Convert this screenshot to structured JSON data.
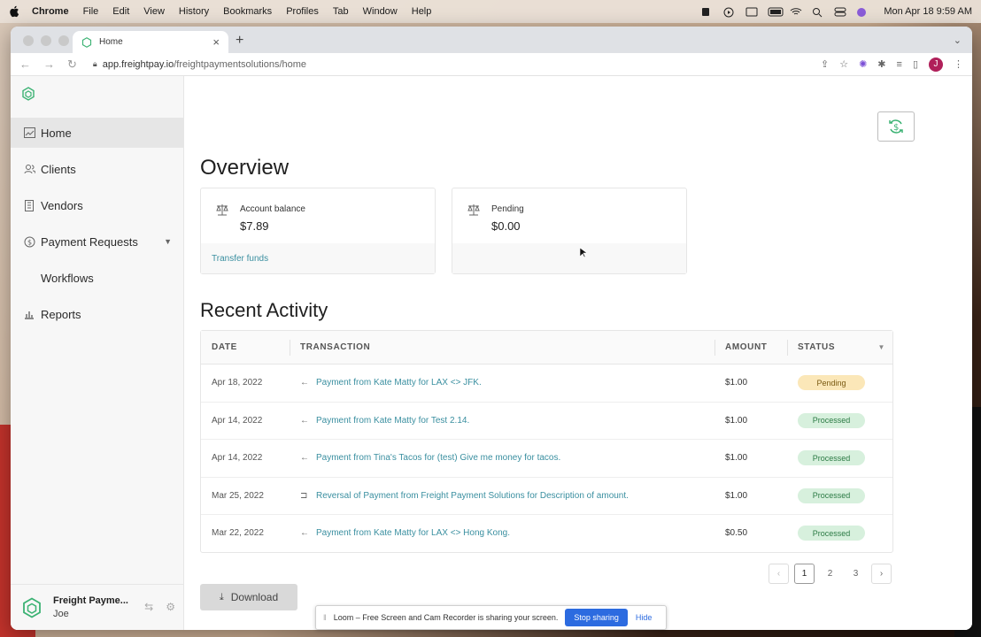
{
  "menubar": {
    "app": "Chrome",
    "items": [
      "File",
      "Edit",
      "View",
      "History",
      "Bookmarks",
      "Profiles",
      "Tab",
      "Window",
      "Help"
    ],
    "clock": "Mon Apr 18  9:59 AM"
  },
  "browser": {
    "tab_title": "Home",
    "url_host": "app.freightpay.io",
    "url_path": "/freightpaymentsolutions/home",
    "profile_initial": "J"
  },
  "sidebar": {
    "items": [
      {
        "label": "Home",
        "icon": "chart-line-icon"
      },
      {
        "label": "Clients",
        "icon": "users-icon"
      },
      {
        "label": "Vendors",
        "icon": "building-icon"
      },
      {
        "label": "Payment Requests",
        "icon": "dollar-circle-icon"
      },
      {
        "label": "Workflows",
        "icon": "workflow-icon"
      },
      {
        "label": "Reports",
        "icon": "bar-chart-icon"
      }
    ],
    "company": "Freight Payme...",
    "user": "Joe"
  },
  "overview": {
    "title": "Overview",
    "balance_label": "Account balance",
    "balance_value": "$7.89",
    "transfer_link": "Transfer funds",
    "pending_label": "Pending",
    "pending_value": "$0.00"
  },
  "activity": {
    "title": "Recent Activity",
    "columns": {
      "date": "DATE",
      "transaction": "TRANSACTION",
      "amount": "AMOUNT",
      "status": "STATUS"
    },
    "rows": [
      {
        "date": "Apr 18, 2022",
        "tx": "Payment from Kate Matty for LAX <> JFK.",
        "amount": "$1.00",
        "status": "Pending"
      },
      {
        "date": "Apr 14, 2022",
        "tx": "Payment from Kate Matty for Test 2.14.",
        "amount": "$1.00",
        "status": "Processed"
      },
      {
        "date": "Apr 14, 2022",
        "tx": "Payment from Tina's Tacos for (test) Give me money for tacos.",
        "amount": "$1.00",
        "status": "Processed"
      },
      {
        "date": "Mar 25, 2022",
        "tx": "Reversal of Payment from Freight Payment Solutions for Description of amount.",
        "amount": "$1.00",
        "status": "Processed"
      },
      {
        "date": "Mar 22, 2022",
        "tx": "Payment from Kate Matty for LAX <> Hong Kong.",
        "amount": "$0.50",
        "status": "Processed"
      }
    ]
  },
  "pagination": {
    "pages": [
      "1",
      "2",
      "3"
    ],
    "current": "1"
  },
  "download_label": "Download",
  "loom": {
    "message": "Loom – Free Screen and Cam Recorder is sharing your screen.",
    "stop": "Stop sharing",
    "hide": "Hide"
  },
  "colors": {
    "accent": "#3a8fa0",
    "brand_green": "#3bb273",
    "pending_badge": "#fbe7b8",
    "processed_badge": "#d7f0dd",
    "loom_blue": "#2c6be0"
  }
}
